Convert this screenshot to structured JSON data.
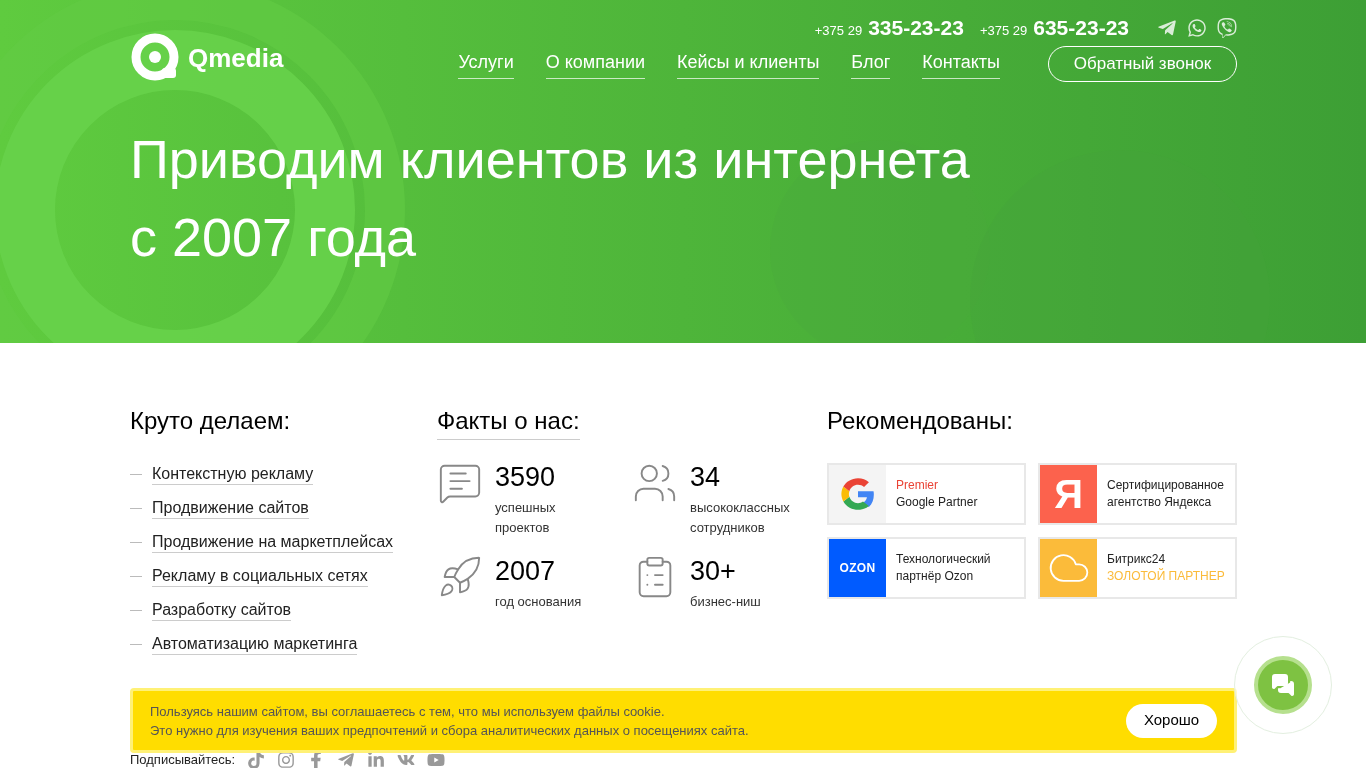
{
  "header": {
    "logo": "Qmedia",
    "phones": [
      {
        "prefix": "+375 29",
        "number": "335-23-23"
      },
      {
        "prefix": "+375 29",
        "number": "635-23-23"
      }
    ],
    "nav": [
      {
        "label": "Услуги"
      },
      {
        "label": "О компании"
      },
      {
        "label": "Кейсы и клиенты"
      },
      {
        "label": "Блог"
      },
      {
        "label": "Контакты"
      }
    ],
    "callback_button": "Обратный звонок"
  },
  "hero_title": [
    "Приводим клиентов из интернета",
    "с 2007 года"
  ],
  "services": {
    "title": "Круто делаем:",
    "items": [
      "Контекстную рекламу",
      "Продвижение сайтов",
      "Продвижение на маркетплейсах",
      "Рекламу в социальных сетях",
      "Разработку сайтов",
      "Автоматизацию маркетинга"
    ]
  },
  "facts": {
    "title": "Факты о нас:",
    "items": [
      {
        "value": "3590",
        "caption_lines": [
          "успешных",
          "проектов"
        ]
      },
      {
        "value": "34",
        "caption_lines": [
          "высококлассных",
          "сотрудников"
        ]
      },
      {
        "value": "2007",
        "caption_lines": [
          "год основания"
        ]
      },
      {
        "value": "30+",
        "caption_lines": [
          "бизнес-ниш"
        ]
      }
    ]
  },
  "partners": {
    "title": "Рекомендованы:",
    "items": [
      {
        "kind": "google",
        "lines": [
          {
            "text": "Premier",
            "accent": true
          },
          {
            "text": "Google Partner",
            "accent": false
          }
        ]
      },
      {
        "kind": "yandex",
        "logo_text": "Я",
        "lines": [
          {
            "text": "Сертифицированное",
            "accent": false
          },
          {
            "text": "агентство Яндекса",
            "accent": false
          }
        ]
      },
      {
        "kind": "ozon",
        "logo_text": "OZON",
        "lines": [
          {
            "text": "Технологический",
            "accent": false
          },
          {
            "text": "партнёр Ozon",
            "accent": false
          }
        ]
      },
      {
        "kind": "bitrix",
        "lines": [
          {
            "text": "Битрикс24",
            "accent": false
          },
          {
            "text": "ЗОЛОТОЙ ПАРТНЕР",
            "accent": true
          }
        ]
      }
    ]
  },
  "cookie": {
    "lines": [
      "Пользуясь нашим сайтом, вы соглашаетесь с тем, что мы используем файлы cookie.",
      "Это нужно для изучения ваших предпочтений и сбора аналитических данных о посещениях сайта."
    ],
    "button": "Хорошо"
  },
  "subscribe_label": "Подписывайтесь:"
}
